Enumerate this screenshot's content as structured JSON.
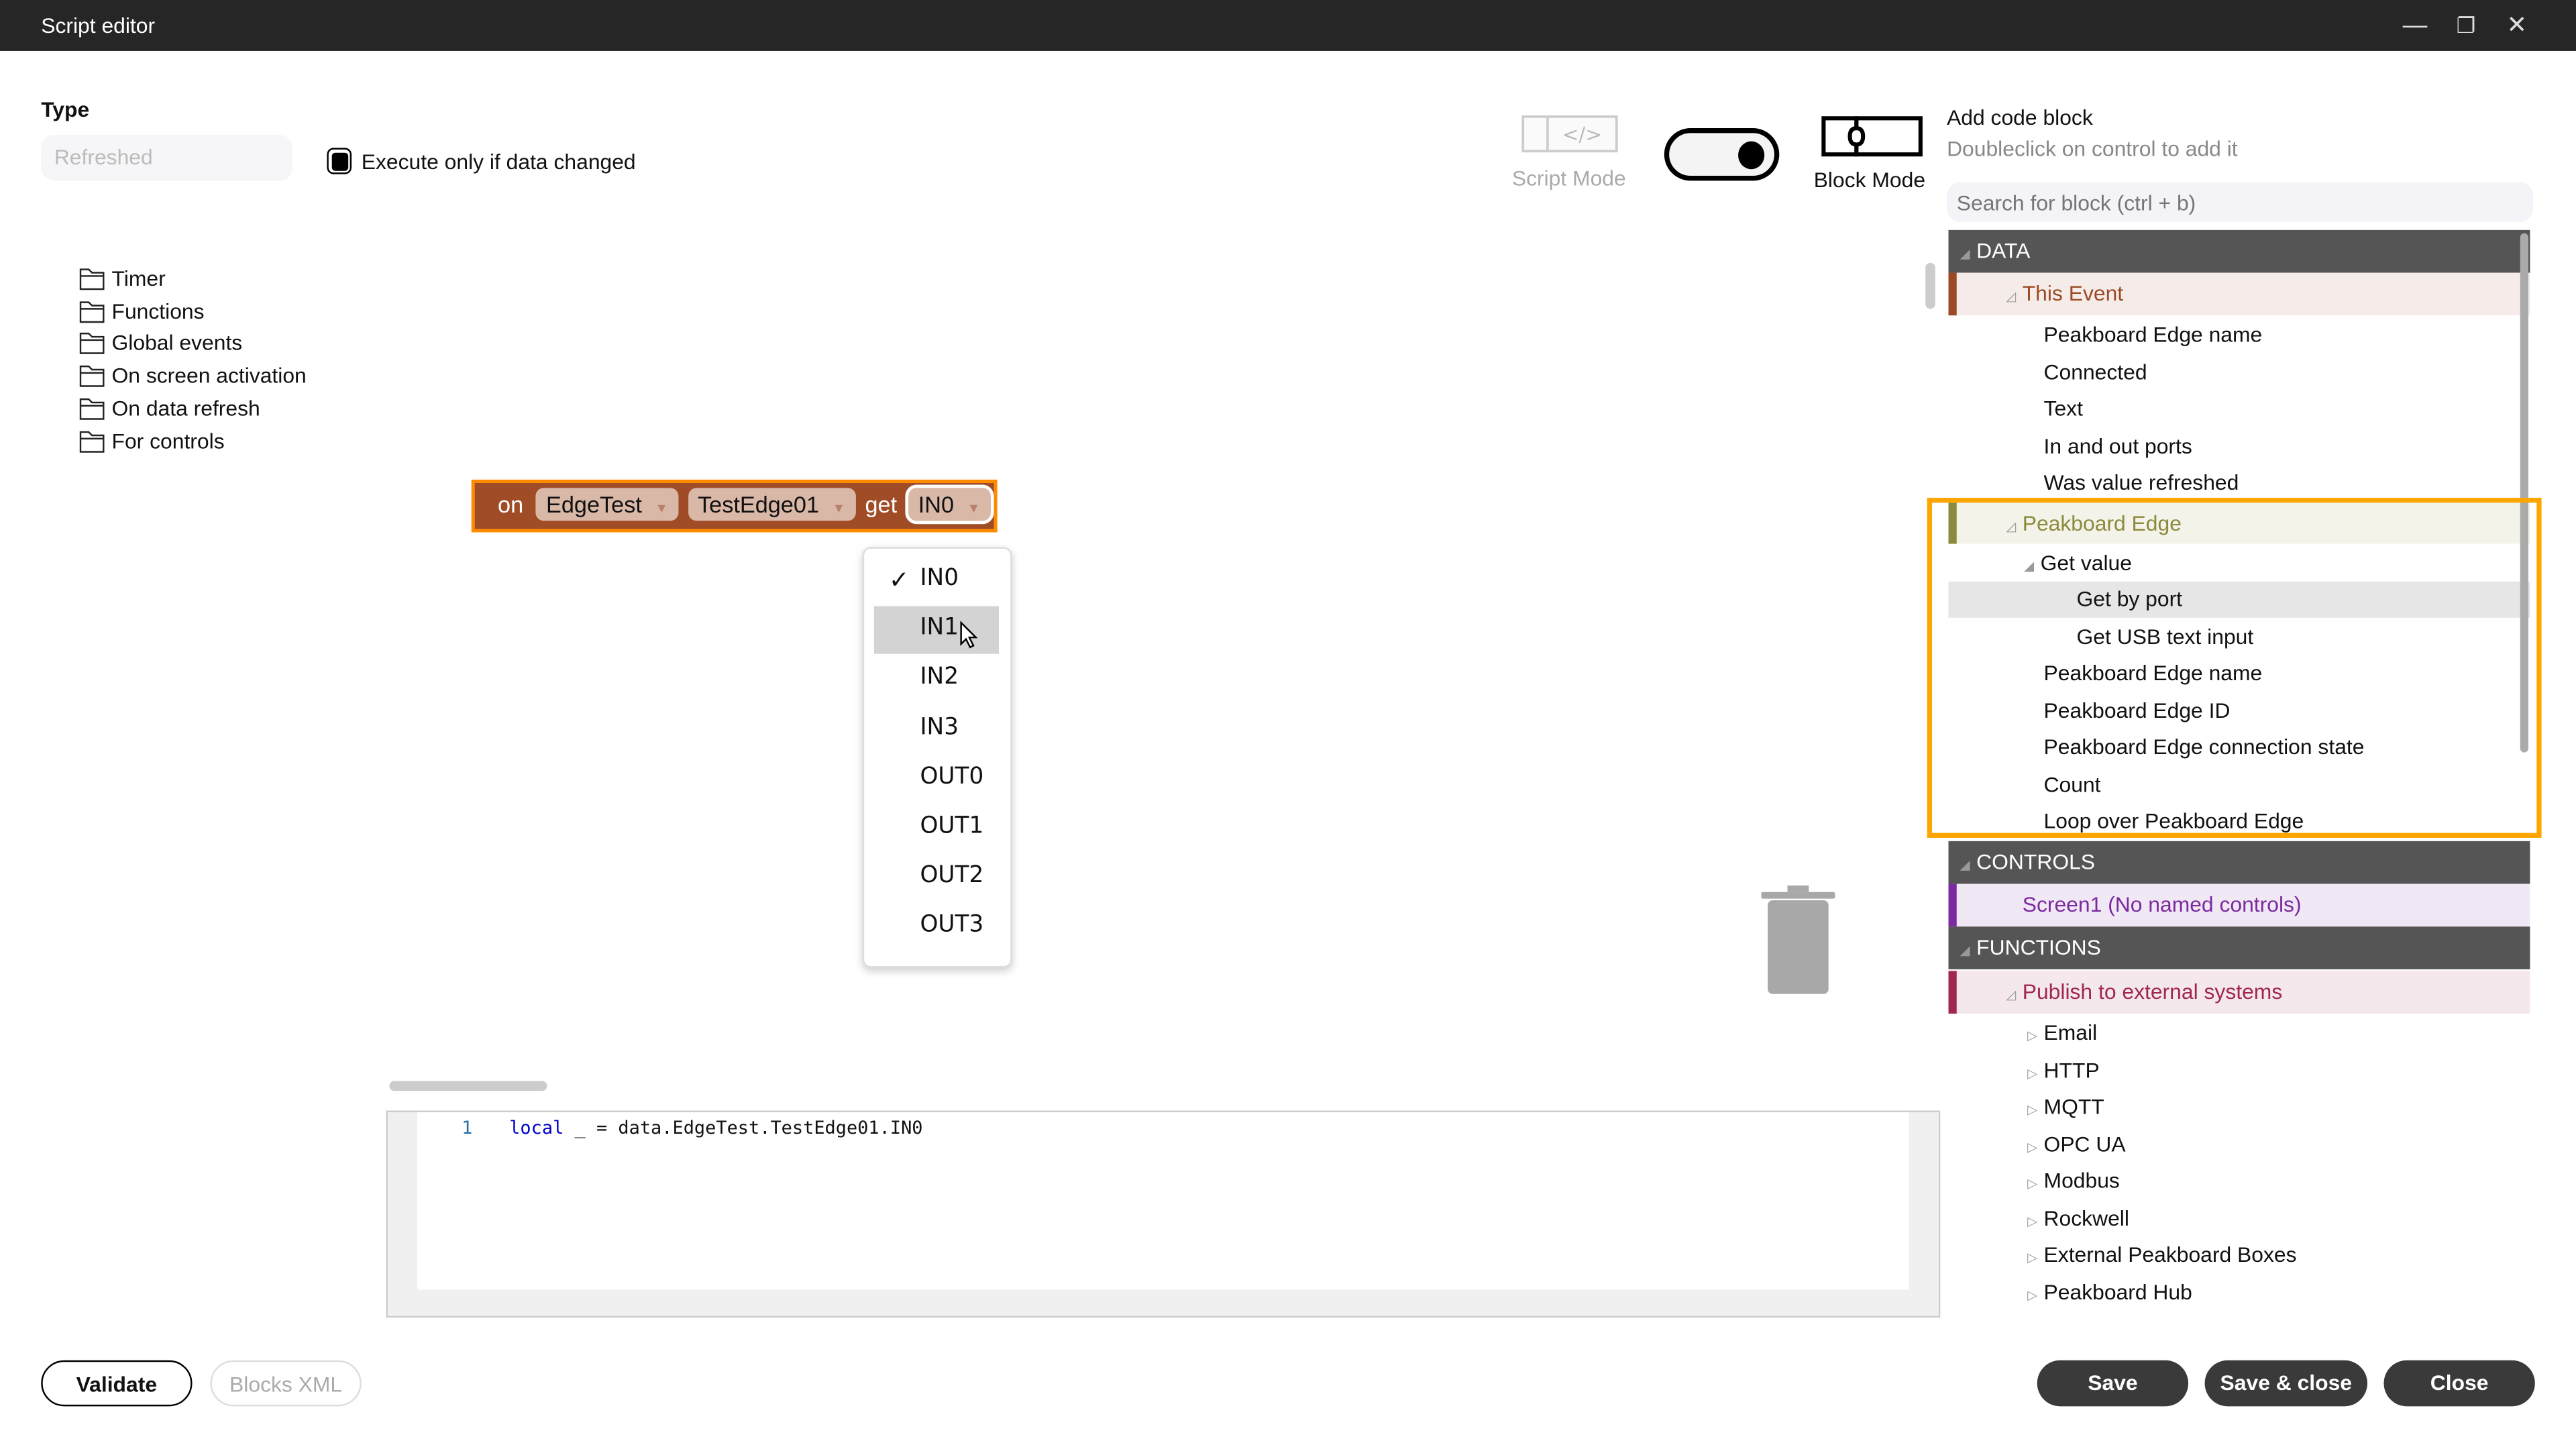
{
  "window": {
    "title": "Script editor",
    "minimize": "—",
    "restore": "❐",
    "close": "✕"
  },
  "type": {
    "label": "Type",
    "value": "Refreshed"
  },
  "execute_only_if_changed": {
    "label": "Execute only if data changed",
    "checked": true
  },
  "modes": {
    "script_label": "Script Mode",
    "block_label": "Block Mode",
    "selected": "Block Mode"
  },
  "add_block": {
    "title": "Add code block",
    "subtitle": "Doubleclick on control to add it",
    "search_placeholder": "Search for block (ctrl + b)"
  },
  "folders": [
    "Timer",
    "Functions",
    "Global events",
    "On screen activation",
    "On data refresh",
    "For controls"
  ],
  "block": {
    "on": "on",
    "source": "EdgeTest",
    "device": "TestEdge01",
    "get": "get",
    "port": "IN0"
  },
  "port_dropdown": {
    "selected": "IN0",
    "hovered": "IN1",
    "check": "✓",
    "options": [
      "IN0",
      "IN1",
      "IN2",
      "IN3",
      "OUT0",
      "OUT1",
      "OUT2",
      "OUT3"
    ]
  },
  "code": {
    "line_number": "1",
    "keyword": "local",
    "rest": " _ = data.EdgeTest.TestEdge01.IN0"
  },
  "tree": {
    "data_header": "DATA",
    "this_event": {
      "label": "This Event",
      "color": "#9c4a26",
      "items": [
        "Peakboard Edge name",
        "Connected",
        "Text",
        "In and out ports",
        "Was value refreshed"
      ]
    },
    "peakboard_edge": {
      "label": "Peakboard Edge",
      "color": "#8c8a3c",
      "get_value": "Get value",
      "get_value_items": [
        "Get by port",
        "Get USB text input"
      ],
      "items": [
        "Peakboard Edge name",
        "Peakboard Edge ID",
        "Peakboard Edge connection state",
        "Count",
        "Loop over Peakboard Edge"
      ]
    },
    "controls_header": "CONTROLS",
    "screen1": {
      "label": "Screen1 (No named controls)",
      "color": "#7b2aa0"
    },
    "functions_header": "FUNCTIONS",
    "publish": {
      "label": "Publish to external systems",
      "color": "#a0284f",
      "items": [
        "Email",
        "HTTP",
        "MQTT",
        "OPC UA",
        "Modbus",
        "Rockwell",
        "External Peakboard Boxes",
        "Peakboard Hub"
      ]
    }
  },
  "highlight_color": "#ffa500",
  "buttons": {
    "validate": "Validate",
    "blocks_xml": "Blocks XML",
    "save": "Save",
    "save_close": "Save & close",
    "close": "Close"
  }
}
